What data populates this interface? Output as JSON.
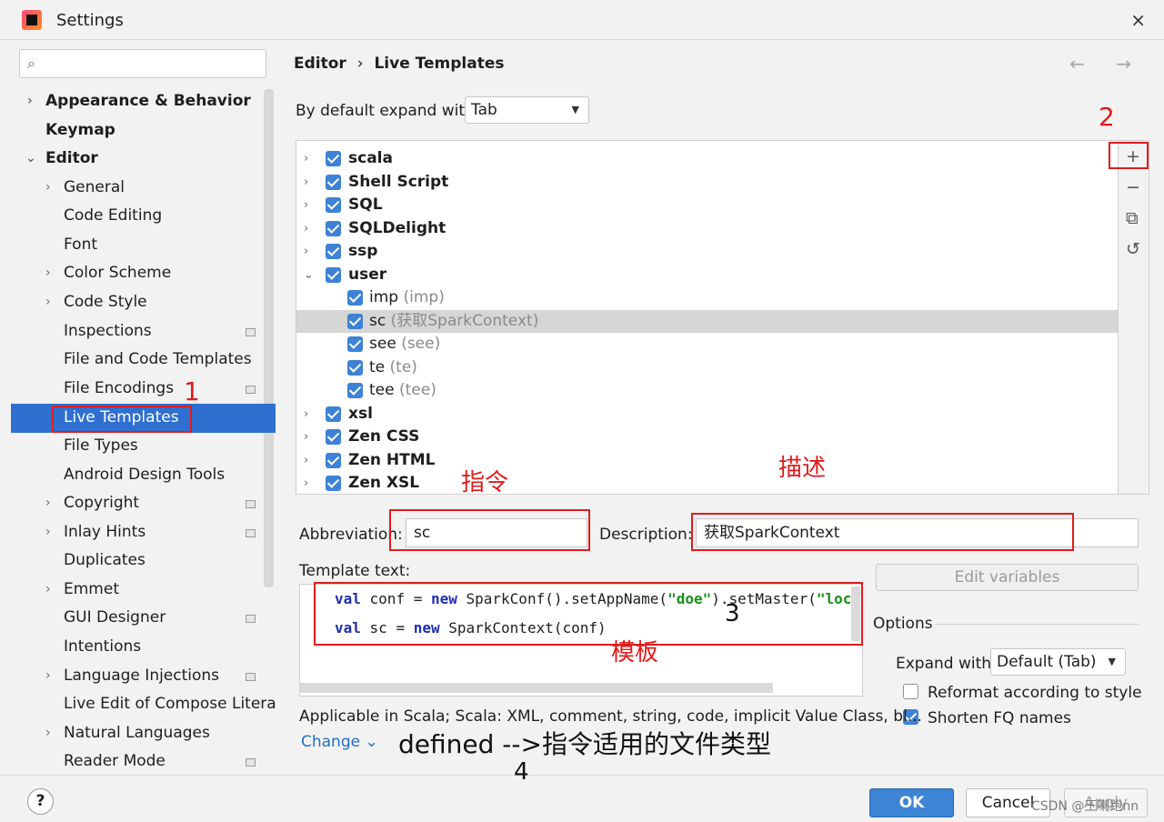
{
  "window": {
    "title": "Settings",
    "close": "×"
  },
  "breadcrumb": {
    "part1": "Editor",
    "separator": "›",
    "part2": "Live Templates"
  },
  "nav_arrows": "← →",
  "sidebar": {
    "items": [
      {
        "label": "Appearance & Behavior",
        "chev": "›"
      },
      {
        "label": "Keymap"
      },
      {
        "label": "Editor",
        "chev": "⌄"
      },
      {
        "label": "General",
        "chev": "›"
      },
      {
        "label": "Code Editing"
      },
      {
        "label": "Font"
      },
      {
        "label": "Color Scheme",
        "chev": "›"
      },
      {
        "label": "Code Style",
        "chev": "›"
      },
      {
        "label": "Inspections"
      },
      {
        "label": "File and Code Templates"
      },
      {
        "label": "File Encodings"
      },
      {
        "label": "Live Templates"
      },
      {
        "label": "File Types"
      },
      {
        "label": "Android Design Tools"
      },
      {
        "label": "Copyright",
        "chev": "›"
      },
      {
        "label": "Inlay Hints",
        "chev": "›"
      },
      {
        "label": "Duplicates"
      },
      {
        "label": "Emmet",
        "chev": "›"
      },
      {
        "label": "GUI Designer"
      },
      {
        "label": "Intentions"
      },
      {
        "label": "Language Injections",
        "chev": "›"
      },
      {
        "label": "Live Edit of Compose Litera"
      },
      {
        "label": "Natural Languages",
        "chev": "›"
      },
      {
        "label": "Reader Mode"
      }
    ]
  },
  "expand": {
    "label": "By default expand with",
    "value": "Tab",
    "caret": "▼"
  },
  "templates": {
    "groups": [
      {
        "name": "scala",
        "chev": "›"
      },
      {
        "name": "Shell Script",
        "chev": "›"
      },
      {
        "name": "SQL",
        "chev": "›"
      },
      {
        "name": "SQLDelight",
        "chev": "›"
      },
      {
        "name": "ssp",
        "chev": "›"
      },
      {
        "name": "user",
        "chev": "⌄"
      }
    ],
    "user_items": [
      {
        "name": "imp",
        "desc": "(imp)"
      },
      {
        "name": "sc",
        "desc": "(获取SparkContext)"
      },
      {
        "name": "see",
        "desc": "(see)"
      },
      {
        "name": "te",
        "desc": "(te)"
      },
      {
        "name": "tee",
        "desc": "(tee)"
      }
    ],
    "groups_after": [
      {
        "name": "xsl",
        "chev": "›"
      },
      {
        "name": "Zen CSS",
        "chev": "›"
      },
      {
        "name": "Zen HTML",
        "chev": "›"
      },
      {
        "name": "Zen XSL",
        "chev": "›"
      }
    ]
  },
  "tools": {
    "add": "+",
    "remove": "−",
    "copy": "⧉",
    "restore": "↺"
  },
  "form": {
    "abbreviation_label": "Abbreviation:",
    "abbreviation_value": "sc",
    "description_label": "Description:",
    "description_value": "获取SparkContext",
    "template_label": "Template text:",
    "line1": {
      "kw1": "val",
      "t1": " conf = ",
      "kw2": "new",
      "t2": " SparkConf().setAppName(",
      "s1": "\"doe\"",
      "t3": ").setMaster(",
      "s2": "\"local"
    },
    "line2": {
      "kw1": "val",
      "t1": " sc = ",
      "kw2": "new",
      "t2": " SparkContext(conf)"
    },
    "edit_variables": "Edit variables",
    "applicable": "Applicable in Scala; Scala: XML, comment, string, code, implicit Value Class, bl...",
    "change": "Change ⌄"
  },
  "options": {
    "title": "Options",
    "expand_with_label": "Expand with",
    "expand_with_value": "Default (Tab)",
    "reformat": "Reformat according to style",
    "shorten": "Shorten FQ names"
  },
  "buttons": {
    "help": "?",
    "ok": "OK",
    "cancel": "Cancel",
    "apply": "Apply"
  },
  "annotations": {
    "n1": "1",
    "n2": "2",
    "n3": "3",
    "n4": "4",
    "zhiling": "指令",
    "miaoshu": "描述",
    "muban": "模板",
    "defined": "defined -->指令适用的文件类型",
    "watermark": "CSDN @王喇跑nn"
  },
  "colors": {
    "accent": "#2e6fd0",
    "annotation": "#e11c1c",
    "checkbox": "#3d82d6"
  }
}
